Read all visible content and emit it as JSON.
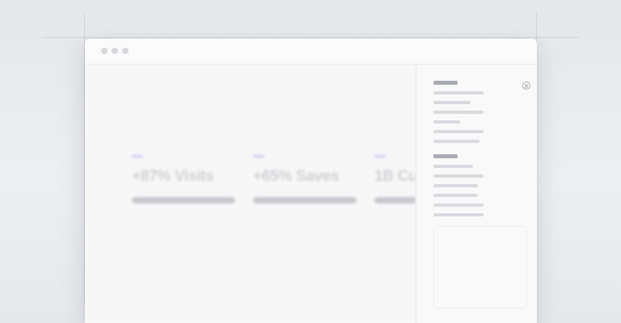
{
  "stats": [
    {
      "value": "+87% Visits",
      "accent": "#c9c9f4"
    },
    {
      "value": "+65% Saves",
      "accent": "#c9c9f4"
    },
    {
      "value": "1B Cu",
      "accent": "#c9c9f4"
    }
  ],
  "colors": {
    "accent": "#c9c9f4",
    "placeholder_heading": "#a9abb3",
    "placeholder_line": "#d9dadf",
    "stat_bar": "#c8c9cf"
  },
  "icons": {
    "window_controls": [
      "window-dot-icon",
      "window-dot-icon",
      "window-dot-icon"
    ],
    "panel_close": "close-circle-icon"
  }
}
